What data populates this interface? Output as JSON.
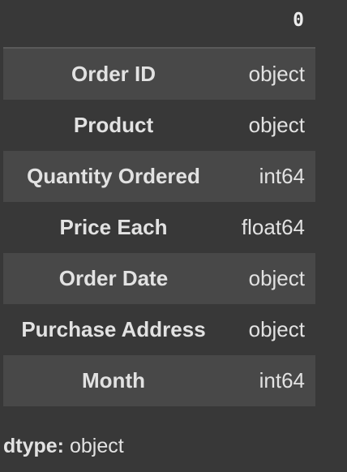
{
  "series": {
    "column_header": "0",
    "rows": [
      {
        "label": "Order ID",
        "value": "object"
      },
      {
        "label": "Product",
        "value": "object"
      },
      {
        "label": "Quantity Ordered",
        "value": "int64"
      },
      {
        "label": "Price Each",
        "value": "float64"
      },
      {
        "label": "Order Date",
        "value": "object"
      },
      {
        "label": "Purchase Address",
        "value": "object"
      },
      {
        "label": "Month",
        "value": "int64"
      }
    ]
  },
  "footer": {
    "key": "dtype:",
    "value": "object"
  },
  "colors": {
    "background": "#383838",
    "stripe": "#484848",
    "text": "#e2e2e2",
    "header_rule": "#5a5a5a"
  }
}
